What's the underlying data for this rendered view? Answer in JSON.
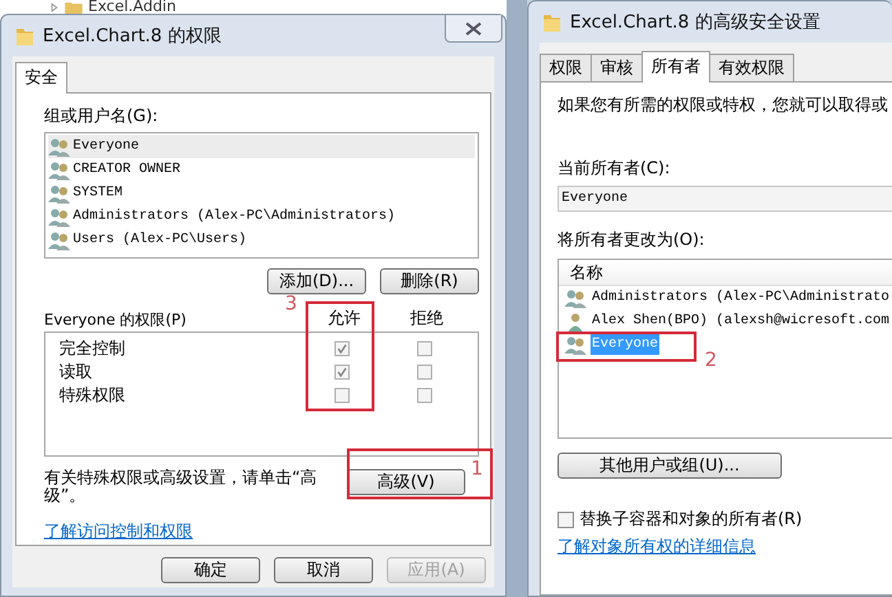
{
  "background": {
    "tree_item": "Excel.Addin"
  },
  "permissions_dialog": {
    "title": "Excel.Chart.8 的权限",
    "tabs": [
      {
        "label": "安全",
        "selected": true
      }
    ],
    "group_label": "组或用户名(G):",
    "users": [
      {
        "name": "Everyone",
        "selected": true
      },
      {
        "name": "CREATOR OWNER",
        "selected": false
      },
      {
        "name": "SYSTEM",
        "selected": false
      },
      {
        "name": "Administrators (Alex-PC\\Administrators)",
        "selected": false
      },
      {
        "name": "Users (Alex-PC\\Users)",
        "selected": false
      }
    ],
    "list_buttons": [
      "添加(D)...",
      "删除(R)"
    ],
    "perm_label": "Everyone 的权限(P)",
    "columns": [
      "允许",
      "拒绝"
    ],
    "permissions": [
      {
        "name": "完全控制",
        "allow": true,
        "deny": false
      },
      {
        "name": "读取",
        "allow": true,
        "deny": false
      },
      {
        "name": "特殊权限",
        "allow": false,
        "deny": false
      }
    ],
    "hint": "有关特殊权限或高级设置，请单击“高级”。",
    "advanced_button": "高级(V)",
    "link": "了解访问控制和权限",
    "footer_buttons": [
      {
        "label": "确定",
        "disabled": false
      },
      {
        "label": "取消",
        "disabled": false
      },
      {
        "label": "应用(A)",
        "disabled": true
      }
    ]
  },
  "advanced_dialog": {
    "title": "Excel.Chart.8 的高级安全设置",
    "tabs": [
      {
        "label": "权限",
        "selected": false
      },
      {
        "label": "审核",
        "selected": false
      },
      {
        "label": "所有者",
        "selected": true
      },
      {
        "label": "有效权限",
        "selected": false
      }
    ],
    "intro": "如果您有所需的权限或特权，您就可以取得或",
    "current_owner_label": "当前所有者(C):",
    "current_owner": "Everyone",
    "change_label": "将所有者更改为(O):",
    "column": "名称",
    "owners": [
      {
        "name": "Administrators (Alex-PC\\Administrato",
        "kind": "group",
        "selected": false
      },
      {
        "name": "Alex Shen(BPO) (alexsh@wicresoft.com",
        "kind": "user",
        "selected": false
      },
      {
        "name": "Everyone",
        "kind": "group",
        "selected": true
      }
    ],
    "other_button": "其他用户或组(U)...",
    "replace": {
      "label": "替换子容器和对象的所有者(R)",
      "checked": false
    },
    "link": "了解对象所有权的详细信息"
  },
  "annotations": [
    {
      "label": "3",
      "kind": "allow-column"
    },
    {
      "label": "1",
      "kind": "advanced-button"
    },
    {
      "label": "2",
      "kind": "owner-row"
    }
  ]
}
